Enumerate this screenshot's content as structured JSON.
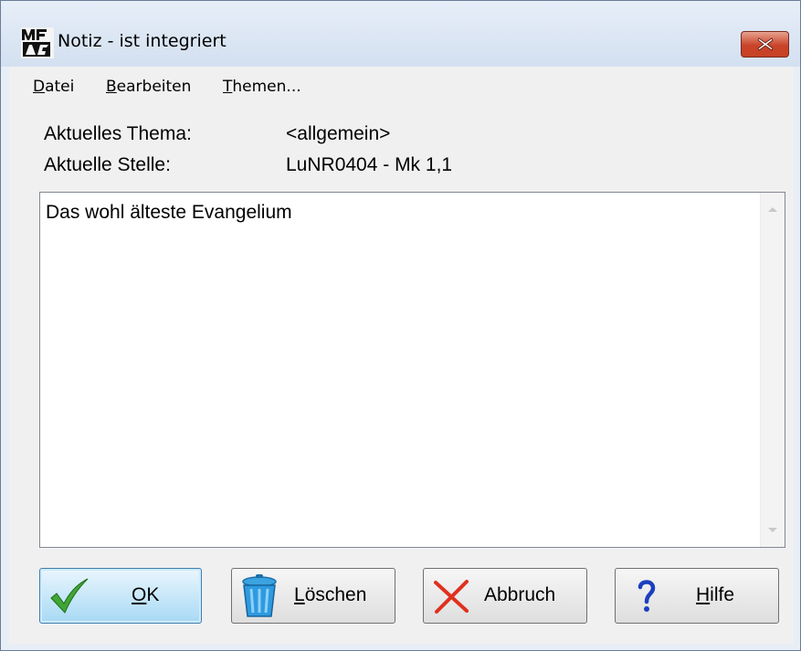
{
  "window": {
    "title": "Notiz - ist integriert",
    "icon": "app-logo-icon",
    "close_icon": "close-icon"
  },
  "menu": {
    "items": [
      {
        "first": "D",
        "rest": "atei"
      },
      {
        "first": "B",
        "rest": "earbeiten"
      },
      {
        "first": "T",
        "rest": "hemen..."
      }
    ]
  },
  "info": {
    "theme_label": "Aktuelles Thema:",
    "theme_value": "<allgemein>",
    "place_label": "Aktuelle Stelle:",
    "place_value": "LuNR0404 - Mk 1,1"
  },
  "note": {
    "text": "Das wohl älteste Evangelium"
  },
  "buttons": {
    "ok": {
      "first": "O",
      "rest": "K",
      "icon": "checkmark-icon"
    },
    "delete": {
      "first": "L",
      "rest": "öschen",
      "icon": "trash-icon"
    },
    "cancel": {
      "label": "Abbruch",
      "icon": "x-icon"
    },
    "help": {
      "first": "H",
      "rest": "ilfe",
      "icon": "question-icon"
    }
  },
  "colors": {
    "close_button": "#c9432a",
    "default_button": "#a7d9f5",
    "check": "#3fa534",
    "cancel_x": "#e0301e",
    "help_q": "#1c3fbf"
  }
}
